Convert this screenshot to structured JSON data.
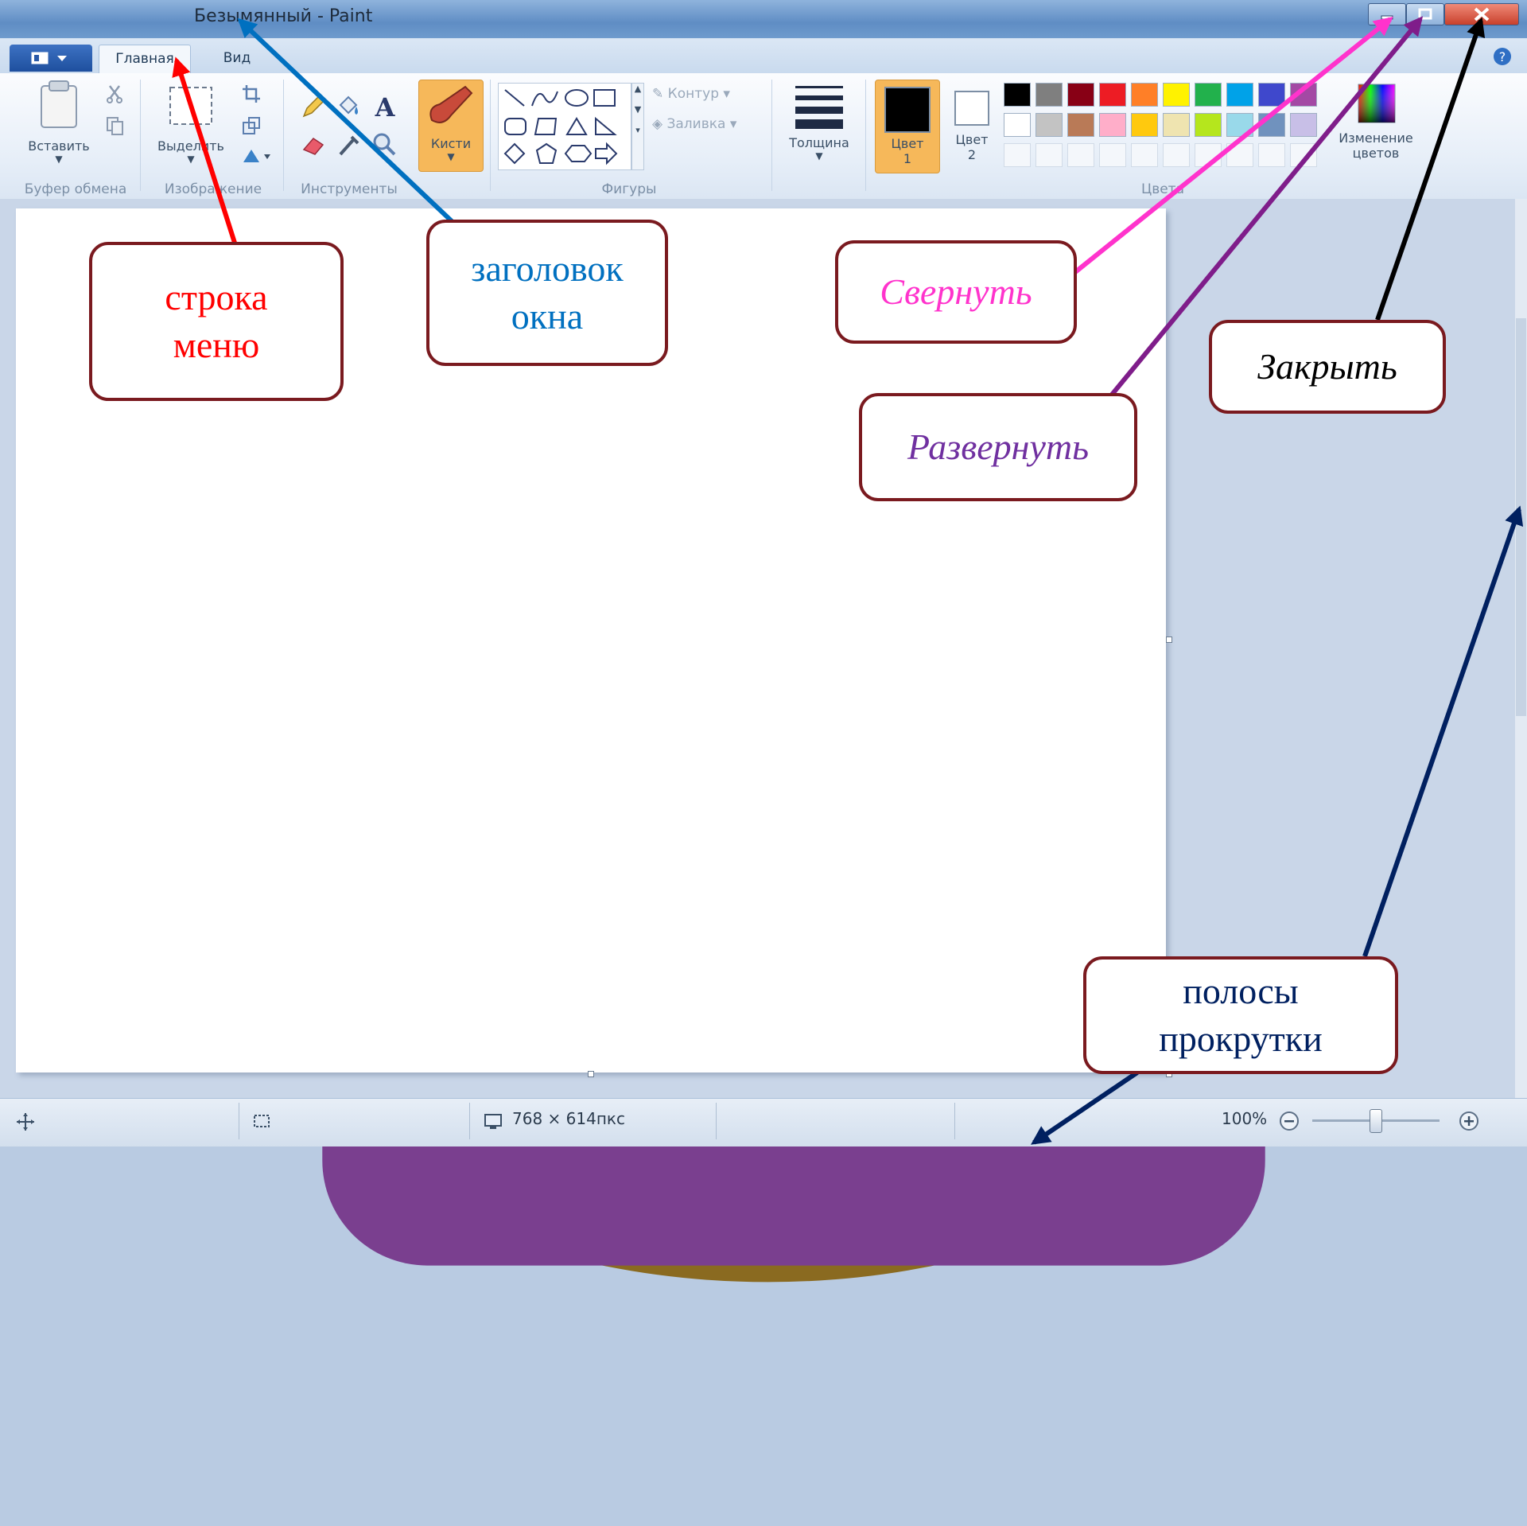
{
  "window": {
    "title": "Безымянный - Paint"
  },
  "tabs": [
    {
      "label": "Главная"
    },
    {
      "label": "Вид"
    }
  ],
  "ribbon": {
    "paste_label": "Вставить",
    "select_label": "Выделить",
    "brushes_label": "Кисти",
    "outline_label": "Контур",
    "fill_label": "Заливка",
    "thickness_label": "Толщина",
    "color1_label": "Цвет\n1",
    "color2_label": "Цвет\n2",
    "edit_colors_label": "Изменение\nцветов",
    "groups": {
      "clipboard": "Буфер обмена",
      "image": "Изображение",
      "tools": "Инструменты",
      "shapes": "Фигуры",
      "colors": "Цвета"
    },
    "palette_row1": [
      "#000000",
      "#7f7f7f",
      "#880015",
      "#ed1c24",
      "#ff7f27",
      "#fff200",
      "#22b14c",
      "#00a2e8",
      "#3f48cc",
      "#a349a4"
    ],
    "palette_row2": [
      "#ffffff",
      "#c3c3c3",
      "#b97a57",
      "#ffaec9",
      "#ffc90e",
      "#efe4b0",
      "#b5e61d",
      "#99d9ea",
      "#7092be",
      "#c8bfe7"
    ],
    "color1": "#000000",
    "color2": "#ffffff",
    "brushes_highlight": "#f6b85a"
  },
  "statusbar": {
    "canvas_size": "768 × 614пкс",
    "zoom": "100%"
  },
  "annotations": {
    "menu_bar": {
      "text": "строка\nменю",
      "color": "#ff0000"
    },
    "window_title": {
      "text": "заголовок\nокна",
      "color": "#0070c0"
    },
    "minimize": {
      "text": "Свернуть",
      "color": "#ff33cc"
    },
    "maximize": {
      "text": "Развернуть",
      "color": "#7030a0"
    },
    "close": {
      "text": "Закрыть",
      "color": "#000000"
    },
    "scrollbars": {
      "text": "полосы\nпрокрутки",
      "color": "#002060"
    }
  }
}
